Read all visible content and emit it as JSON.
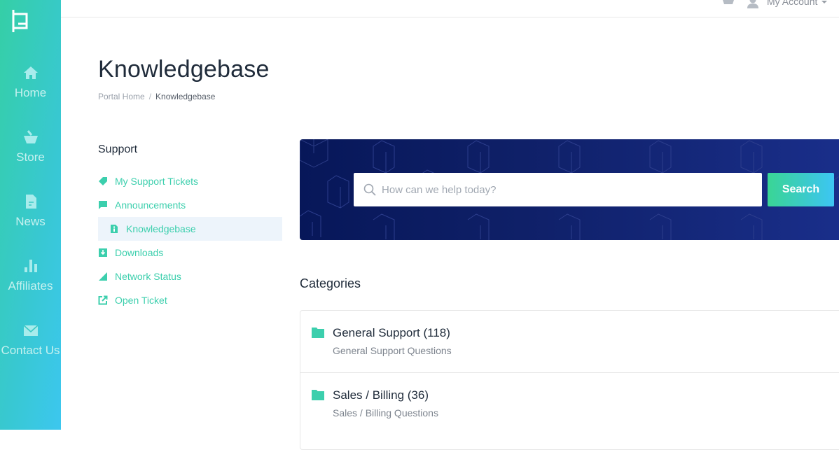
{
  "sidebar": {
    "logo": "brand-logo",
    "items": [
      {
        "label": "Home",
        "icon": "home-icon"
      },
      {
        "label": "Store",
        "icon": "basket-icon"
      },
      {
        "label": "News",
        "icon": "document-icon"
      },
      {
        "label": "Affiliates",
        "icon": "bar-chart-icon"
      },
      {
        "label": "Contact Us",
        "icon": "envelope-icon"
      }
    ]
  },
  "header": {
    "cart_icon": "cart-icon",
    "user_icon": "user-icon",
    "account_label": "My Account"
  },
  "page": {
    "title": "Knowledgebase",
    "breadcrumb": [
      {
        "label": "Portal Home"
      },
      {
        "label": "Knowledgebase"
      }
    ],
    "breadcrumb_separator": "/"
  },
  "support_menu": {
    "title": "Support",
    "items": [
      {
        "label": "My Support Tickets",
        "icon": "ticket-icon",
        "active": false
      },
      {
        "label": "Announcements",
        "icon": "comment-icon",
        "active": false
      },
      {
        "label": "Knowledgebase",
        "icon": "info-document-icon",
        "active": true
      },
      {
        "label": "Downloads",
        "icon": "download-icon",
        "active": false
      },
      {
        "label": "Network Status",
        "icon": "signal-icon",
        "active": false
      },
      {
        "label": "Open Ticket",
        "icon": "external-link-icon",
        "active": false
      }
    ]
  },
  "search": {
    "placeholder": "How can we help today?",
    "value": "",
    "button_label": "Search"
  },
  "categories": {
    "title": "Categories",
    "items": [
      {
        "name": "General Support (118)",
        "description": "General Support Questions"
      },
      {
        "name": "Sales / Billing (36)",
        "description": "Sales / Billing Questions"
      }
    ]
  },
  "colors": {
    "accent": "#3ccfad",
    "banner": "#0f2068",
    "active_bg": "#edf4fb"
  }
}
